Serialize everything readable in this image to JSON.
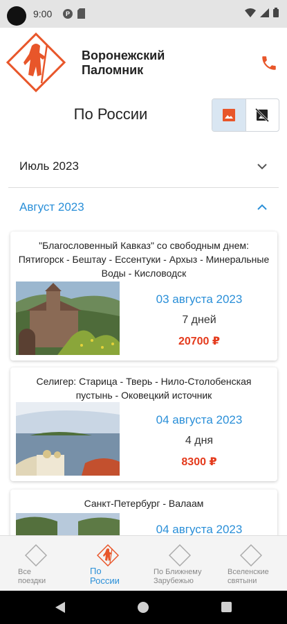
{
  "status_bar": {
    "time": "9:00",
    "p_badge": "P"
  },
  "header": {
    "title_line1": "Воронежский",
    "title_line2": "Паломник"
  },
  "section": {
    "title": "По России"
  },
  "months": [
    {
      "label": "Июль 2023",
      "expanded": false
    },
    {
      "label": "Август 2023",
      "expanded": true
    }
  ],
  "trips": [
    {
      "title": "\"Благословенный Кавказ\" со свободным днем: Пятигорск - Бештау - Ессентуки - Архыз - Минеральные Воды - Кисловодск",
      "date": "03 августа 2023",
      "duration": "7 дней",
      "price": "20700 ₽"
    },
    {
      "title": "Селигер: Старица - Тверь - Нило-Столобенская пустынь - Оковецкий источник",
      "date": "04 августа 2023",
      "duration": "4 дня",
      "price": "8300 ₽"
    },
    {
      "title": "Санкт-Петербург - Валаам",
      "date": "04 августа 2023"
    }
  ],
  "bottom_nav": [
    {
      "line1": "Все",
      "line2": "поездки",
      "active": false
    },
    {
      "line1": "По",
      "line2": "России",
      "active": true
    },
    {
      "line1": "По Ближнему",
      "line2": "Зарубежью",
      "active": false
    },
    {
      "line1": "Вселенские",
      "line2": "святыни",
      "active": false
    }
  ],
  "colors": {
    "accent_blue": "#2a8fd8",
    "price_red": "#e43a1c",
    "brand_orange": "#e8562a"
  }
}
